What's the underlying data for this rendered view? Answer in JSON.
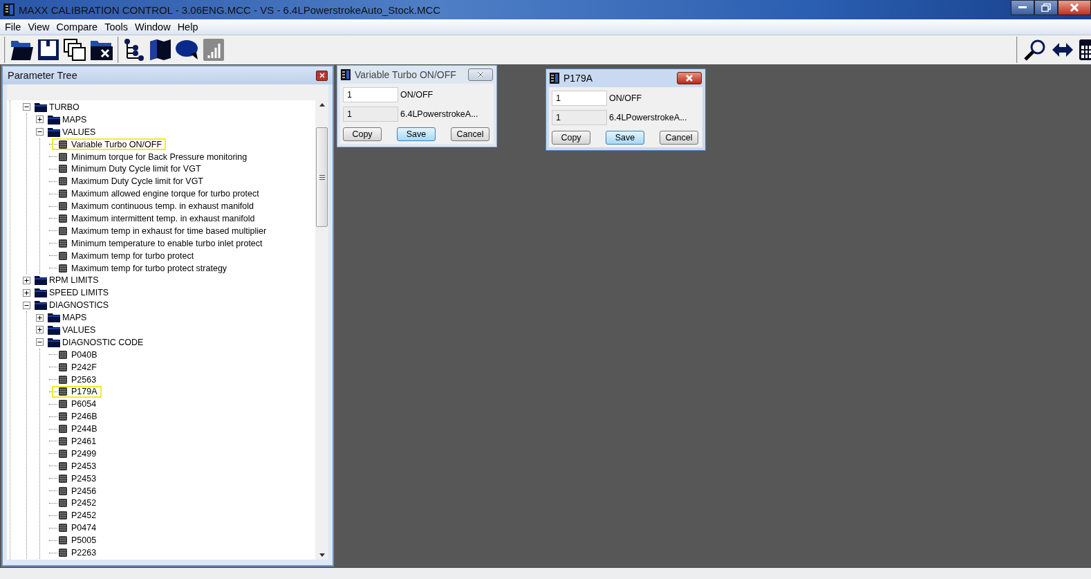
{
  "window": {
    "title": "MAXX CALIBRATION CONTROL - 3.06ENG.MCC - VS - 6.4LPowerstrokeAuto_Stock.MCC"
  },
  "menu": [
    "File",
    "View",
    "Compare",
    "Tools",
    "Window",
    "Help"
  ],
  "parameter_tree": {
    "title": "Parameter Tree",
    "nodes": [
      {
        "label": "TURBO",
        "kind": "folder",
        "expanded": true,
        "children": [
          {
            "label": "MAPS",
            "kind": "folder",
            "expanded": false
          },
          {
            "label": "VALUES",
            "kind": "folder",
            "expanded": true,
            "children": [
              {
                "label": "Variable Turbo ON/OFF",
                "kind": "item",
                "highlighted": true
              },
              {
                "label": "Minimum torque for Back Pressure monitoring",
                "kind": "item",
                "highlighted": false
              },
              {
                "label": "Minimum Duty Cycle limit for VGT",
                "kind": "item",
                "highlighted": false
              },
              {
                "label": "Maximum Duty Cycle limit for VGT",
                "kind": "item",
                "highlighted": false
              },
              {
                "label": "Maximum allowed engine torque for turbo protect",
                "kind": "item",
                "highlighted": false
              },
              {
                "label": "Maximum continuous temp. in exhaust manifold",
                "kind": "item",
                "highlighted": false
              },
              {
                "label": "Maximum intermittent temp. in exhaust manifold",
                "kind": "item",
                "highlighted": false
              },
              {
                "label": "Maximum temp in exhaust for time based multiplier",
                "kind": "item",
                "highlighted": false
              },
              {
                "label": "Minimum temperature to enable turbo inlet protect",
                "kind": "item",
                "highlighted": false
              },
              {
                "label": "Maximum temp for turbo protect",
                "kind": "item",
                "highlighted": false
              },
              {
                "label": "Maximum temp for turbo protect strategy",
                "kind": "item",
                "highlighted": false
              }
            ]
          }
        ]
      },
      {
        "label": "RPM LIMITS",
        "kind": "folder",
        "expanded": false
      },
      {
        "label": "SPEED LIMITS",
        "kind": "folder",
        "expanded": false
      },
      {
        "label": "DIAGNOSTICS",
        "kind": "folder",
        "expanded": true,
        "children": [
          {
            "label": "MAPS",
            "kind": "folder",
            "expanded": false
          },
          {
            "label": "VALUES",
            "kind": "folder",
            "expanded": false
          },
          {
            "label": "DIAGNOSTIC CODE",
            "kind": "folder",
            "expanded": true,
            "children": [
              {
                "label": "P040B",
                "kind": "item",
                "highlighted": false
              },
              {
                "label": "P242F",
                "kind": "item",
                "highlighted": false
              },
              {
                "label": "P2563",
                "kind": "item",
                "highlighted": false
              },
              {
                "label": "P179A",
                "kind": "item",
                "highlighted": true
              },
              {
                "label": "P6054",
                "kind": "item",
                "highlighted": false
              },
              {
                "label": "P246B",
                "kind": "item",
                "highlighted": false
              },
              {
                "label": "P244B",
                "kind": "item",
                "highlighted": false
              },
              {
                "label": "P2461",
                "kind": "item",
                "highlighted": false
              },
              {
                "label": "P2499",
                "kind": "item",
                "highlighted": false
              },
              {
                "label": "P2453",
                "kind": "item",
                "highlighted": false
              },
              {
                "label": "P2453",
                "kind": "item",
                "highlighted": false
              },
              {
                "label": "P2456",
                "kind": "item",
                "highlighted": false
              },
              {
                "label": "P2452",
                "kind": "item",
                "highlighted": false
              },
              {
                "label": "P2452",
                "kind": "item",
                "highlighted": false
              },
              {
                "label": "P0474",
                "kind": "item",
                "highlighted": false
              },
              {
                "label": "P5005",
                "kind": "item",
                "highlighted": false
              },
              {
                "label": "P2263",
                "kind": "item",
                "highlighted": false
              }
            ]
          }
        ]
      }
    ]
  },
  "dialogs": [
    {
      "title": "Variable Turbo ON/OFF",
      "active": false,
      "value": "1",
      "value_label": "ON/OFF",
      "reference_value": "1",
      "reference_label": "6.4LPowerstrokeA...",
      "buttons": [
        {
          "label": "Copy",
          "default": false
        },
        {
          "label": "Save",
          "default": true
        },
        {
          "label": "Cancel",
          "default": false
        }
      ]
    },
    {
      "title": "P179A",
      "active": true,
      "value": "1",
      "value_label": "ON/OFF",
      "reference_value": "1",
      "reference_label": "6.4LPowerstrokeA...",
      "buttons": [
        {
          "label": "Copy",
          "default": false
        },
        {
          "label": "Save",
          "default": true
        },
        {
          "label": "Cancel",
          "default": false
        }
      ]
    }
  ]
}
